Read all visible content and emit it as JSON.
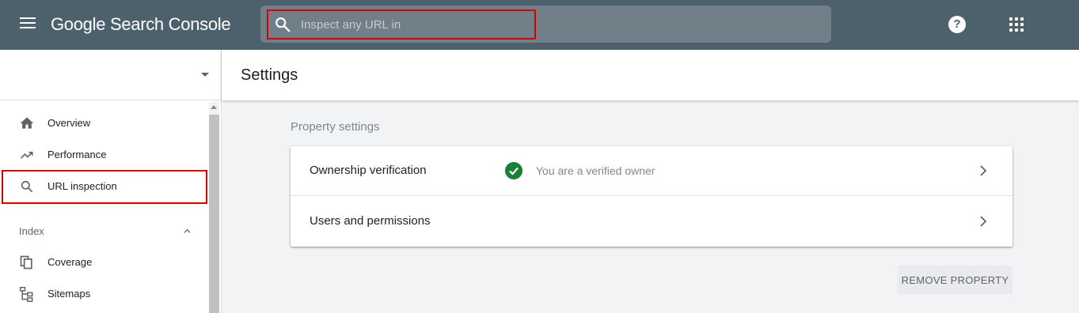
{
  "header": {
    "app_name": "Google Search Console",
    "search": {
      "placeholder": "Inspect any URL in",
      "value": ""
    }
  },
  "sidebar": {
    "items": [
      {
        "label": "Overview",
        "icon": "home-icon"
      },
      {
        "label": "Performance",
        "icon": "trending-up-icon"
      },
      {
        "label": "URL inspection",
        "icon": "search-icon"
      }
    ],
    "index_section": {
      "label": "Index",
      "items": [
        {
          "label": "Coverage",
          "icon": "coverage-icon"
        },
        {
          "label": "Sitemaps",
          "icon": "sitemap-icon"
        }
      ]
    }
  },
  "main": {
    "title": "Settings",
    "property_settings_label": "Property settings",
    "rows": [
      {
        "label": "Ownership verification",
        "status": "You are a verified owner"
      },
      {
        "label": "Users and permissions"
      }
    ],
    "remove_button": "REMOVE PROPERTY"
  },
  "colors": {
    "topbar": "#4d616d",
    "highlight": "#d40000",
    "verified": "#188038"
  }
}
